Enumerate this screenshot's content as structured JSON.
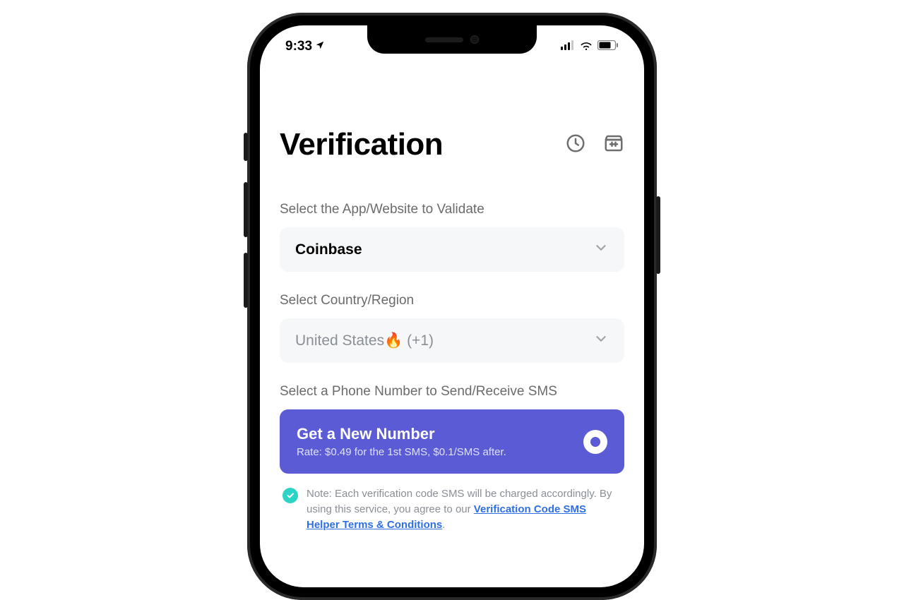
{
  "status_bar": {
    "time": "9:33"
  },
  "header": {
    "title": "Verification"
  },
  "sections": {
    "app_label": "Select the App/Website to Validate",
    "app_value": "Coinbase",
    "country_label": "Select Country/Region",
    "country_prefix": "United States",
    "country_suffix": " (+1)",
    "phone_label": "Select a Phone Number to Send/Receive SMS",
    "primary_title": "Get a New Number",
    "primary_sub": "Rate: $0.49 for the 1st SMS, $0.1/SMS after."
  },
  "note": {
    "prefix": "Note: Each verification code SMS will be charged accordingly. By using this service, you agree to our ",
    "link_text": "Verification Code SMS Helper Terms & Conditions",
    "suffix": "."
  }
}
